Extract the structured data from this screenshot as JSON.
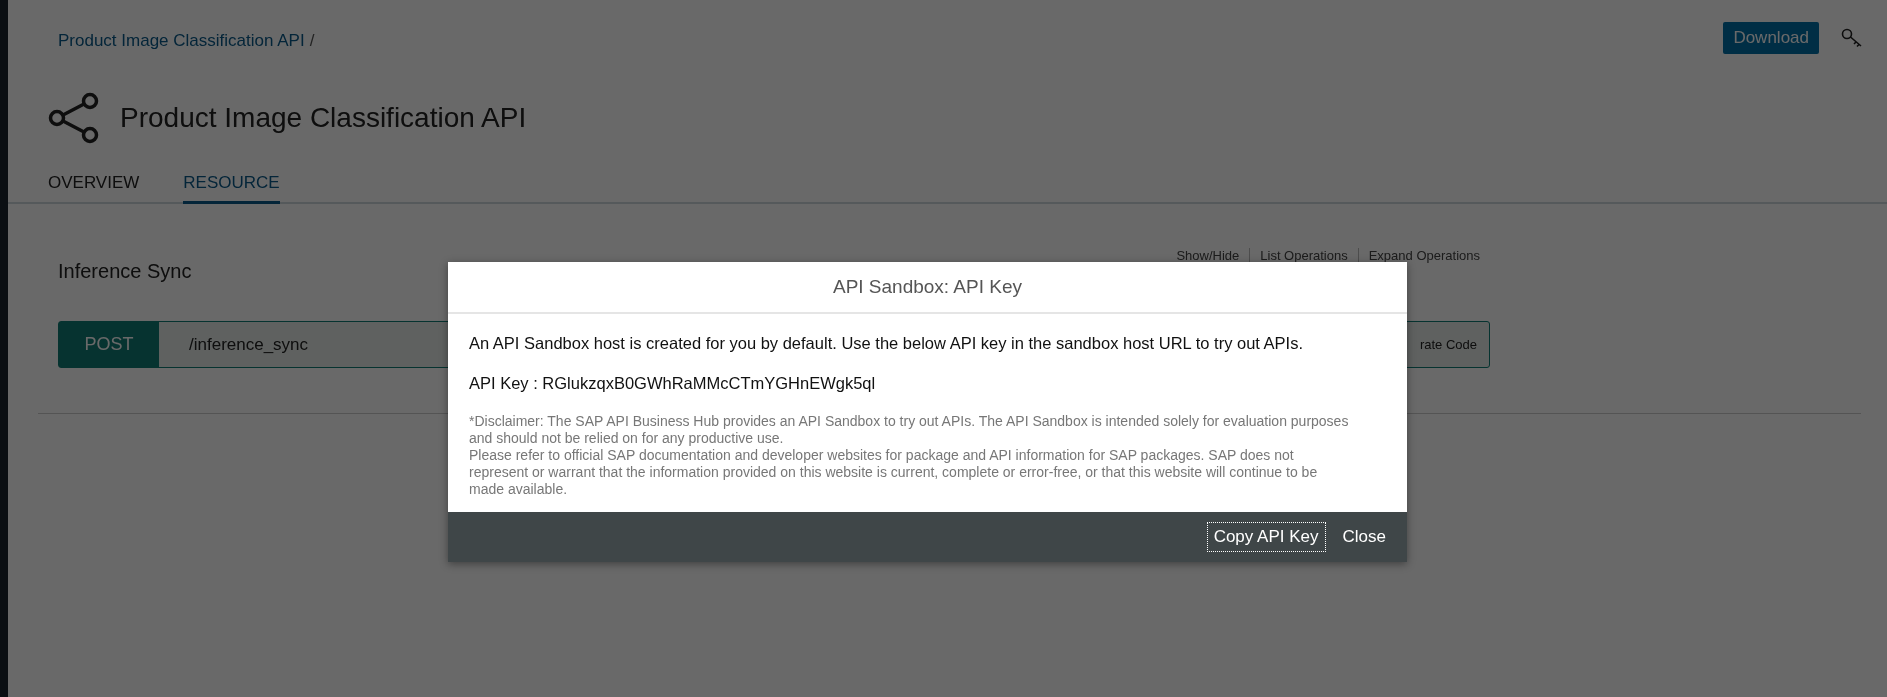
{
  "breadcrumb": {
    "link": "Product Image Classification API",
    "separator": "/"
  },
  "header": {
    "download_button": "Download",
    "title": "Product Image Classification API"
  },
  "tabs": [
    {
      "label": "OVERVIEW",
      "selected": false
    },
    {
      "label": "RESOURCE",
      "selected": true
    }
  ],
  "resource": {
    "title": "Inference Sync",
    "actions": [
      "Show/Hide",
      "List Operations",
      "Expand Operations"
    ],
    "operation": {
      "method": "POST",
      "path": "/inference_sync",
      "button": "rate Code"
    }
  },
  "dialog": {
    "title": "API Sandbox: API Key",
    "intro": "An API Sandbox host is created for you by default. Use the below API key in the sandbox host URL to try out APIs.",
    "api_key": "API Key : RGlukzqxB0GWhRaMMcCTmYGHnEWgk5ql",
    "disclaimer": [
      "*Disclaimer: The SAP API Business Hub provides an API Sandbox to try out APIs. The API Sandbox is intended solely for evaluation purposes and should not be relied on for any productive use.",
      "Please refer to official SAP documentation and developer websites for package and API information for SAP packages. SAP does not represent or warrant that the information provided on this website is current, complete or error-free, or that this website will continue to be made available."
    ],
    "buttons": [
      {
        "label": "Copy API Key",
        "focused": true
      },
      {
        "label": "Close",
        "focused": false
      }
    ]
  }
}
